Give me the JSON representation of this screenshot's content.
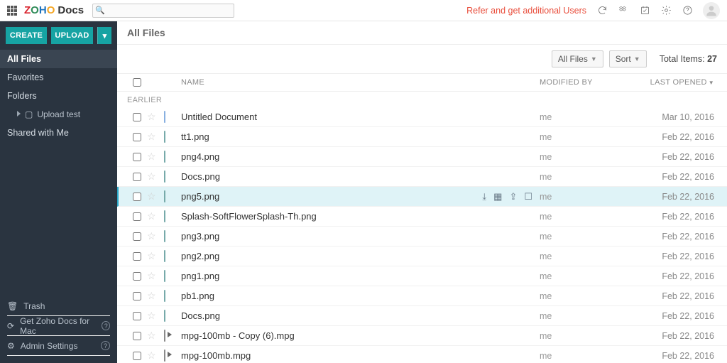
{
  "brand": {
    "z": "Z",
    "o1": "O",
    "h": "H",
    "o2": "O",
    "docs": "Docs"
  },
  "search": {
    "placeholder": ""
  },
  "promo": "Refer and get additional Users",
  "sidebar": {
    "create": "CREATE",
    "upload": "UPLOAD",
    "nav": [
      {
        "label": "All Files",
        "active": true
      },
      {
        "label": "Favorites"
      },
      {
        "label": "Folders"
      },
      {
        "label": "Upload test",
        "sub": true
      },
      {
        "label": "Shared with Me"
      }
    ],
    "bottom": [
      {
        "icon": "🗑",
        "label": "Trash"
      },
      {
        "icon": "⟳",
        "label": "Get Zoho Docs for Mac",
        "help": true
      },
      {
        "icon": "⚙",
        "label": "Admin Settings",
        "help": true
      }
    ]
  },
  "main": {
    "title": "All Files",
    "filter": "All Files",
    "sort": "Sort",
    "totals_label": "Total Items:",
    "totals_count": "27",
    "columns": {
      "name": "NAME",
      "modified": "MODIFIED BY",
      "opened": "LAST OPENED"
    },
    "group": "EARLIER",
    "rows": [
      {
        "icon": "doc",
        "name": "Untitled Document",
        "mod": "me",
        "open": "Mar 10, 2016"
      },
      {
        "icon": "img",
        "name": "tt1.png",
        "mod": "me",
        "open": "Feb 22, 2016"
      },
      {
        "icon": "img",
        "name": "png4.png",
        "mod": "me",
        "open": "Feb 22, 2016"
      },
      {
        "icon": "img",
        "name": "Docs.png",
        "mod": "me",
        "open": "Feb 22, 2016"
      },
      {
        "icon": "img",
        "name": "png5.png",
        "mod": "me",
        "open": "Feb 22, 2016",
        "selected": true,
        "actions": true
      },
      {
        "icon": "img",
        "name": "Splash-SoftFlowerSplash-Th.png",
        "mod": "me",
        "open": "Feb 22, 2016"
      },
      {
        "icon": "img",
        "name": "png3.png",
        "mod": "me",
        "open": "Feb 22, 2016"
      },
      {
        "icon": "img",
        "name": "png2.png",
        "mod": "me",
        "open": "Feb 22, 2016"
      },
      {
        "icon": "img",
        "name": "png1.png",
        "mod": "me",
        "open": "Feb 22, 2016"
      },
      {
        "icon": "img",
        "name": "pb1.png",
        "mod": "me",
        "open": "Feb 22, 2016"
      },
      {
        "icon": "img",
        "name": "Docs.png",
        "mod": "me",
        "open": "Feb 22, 2016"
      },
      {
        "icon": "vid",
        "name": "mpg-100mb - Copy (6).mpg",
        "mod": "me",
        "open": "Feb 22, 2016"
      },
      {
        "icon": "vid",
        "name": "mpg-100mb.mpg",
        "mod": "me",
        "open": "Feb 22, 2016"
      }
    ]
  }
}
